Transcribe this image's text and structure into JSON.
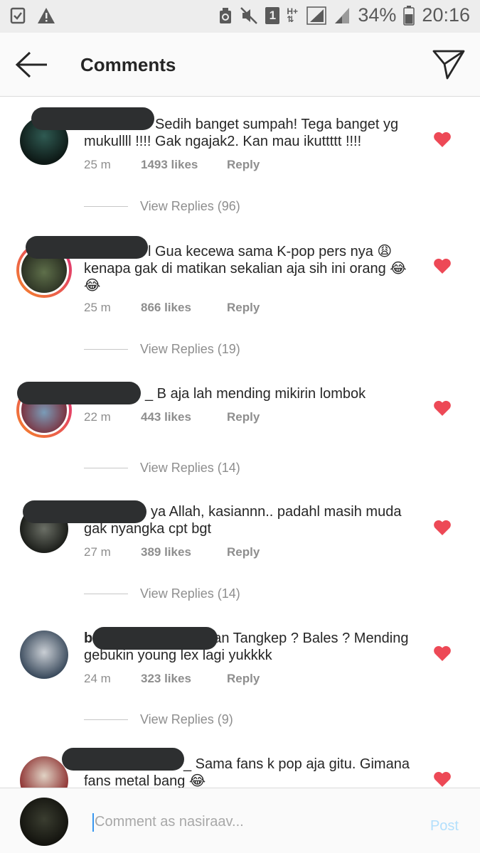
{
  "status_bar": {
    "battery": "34%",
    "time": "20:16",
    "sim_badge": "1",
    "network": "H+"
  },
  "header": {
    "title": "Comments"
  },
  "comments": [
    {
      "prefix": "",
      "text": "Sedih banget sumpah! Tega banget yg mukullll !!!! Gak ngajak2. Kan mau ikuttttt !!!!",
      "time": "25 m",
      "likes": "1493 likes",
      "reply": "Reply",
      "view_replies": "View Replies (96)"
    },
    {
      "prefix": "",
      "text": "l Gua kecewa sama K-pop pers nya 😩 kenapa gak di matikan sekalian aja sih ini orang 😂 😂",
      "time": "25 m",
      "likes": "866 likes",
      "reply": "Reply",
      "view_replies": "View Replies (19)"
    },
    {
      "prefix": "",
      "text": "_ B aja lah mending mikirin lombok",
      "time": "22 m",
      "likes": "443 likes",
      "reply": "Reply",
      "view_replies": "View Replies (14)"
    },
    {
      "prefix": "",
      "text": "ya Allah, kasiannn.. padahl masih muda gak nyangka cpt bgt",
      "time": "27 m",
      "likes": "389 likes",
      "reply": "Reply",
      "view_replies": "View Replies (14)"
    },
    {
      "prefix": "b",
      "text": "an Tangkep ? Bales ? Mending gebukin young lex lagi yukkkk",
      "time": "24 m",
      "likes": "323 likes",
      "reply": "Reply",
      "view_replies": "View Replies (9)"
    },
    {
      "prefix": "",
      "text": "_ Sama fans k pop aja gitu. Gimana fans metal bang 😂",
      "time": "",
      "likes": "",
      "reply": "",
      "view_replies": ""
    }
  ],
  "composer": {
    "placeholder": "Comment as nasiraav...",
    "post_label": "Post"
  },
  "colors": {
    "heart": "#ed4956",
    "post": "#b2dffc",
    "meta": "#8e8e8e"
  }
}
